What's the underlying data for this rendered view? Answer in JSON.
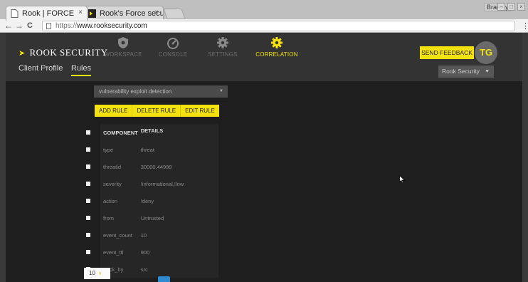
{
  "browser": {
    "tabs": [
      {
        "title": "Rook | FORCE",
        "close": "×"
      },
      {
        "title": "Rook's Force secur",
        "close": "×"
      }
    ],
    "user": "Bradley",
    "window_controls": [
      "–",
      "□",
      "×"
    ],
    "nav": {
      "back": "←",
      "forward": "→",
      "reload": "C"
    },
    "url": {
      "protocol": "https://",
      "host": "www.rooksecurity.com"
    },
    "menu": "⋮"
  },
  "app": {
    "logo": {
      "mark": "➤",
      "text": "ROOK  SECURITY"
    },
    "nav": [
      {
        "label": "WORKSPACE",
        "icon": "shield-icon",
        "active": false
      },
      {
        "label": "CONSOLE",
        "icon": "gauge-icon",
        "active": false
      },
      {
        "label": "SETTINGS",
        "icon": "gear-icon",
        "active": false
      },
      {
        "label": "CORRELATION",
        "icon": "gear-icon",
        "active": true
      }
    ],
    "subnav": [
      "Client Profile",
      "Rules"
    ],
    "feedback": "SEND FEEDBACK",
    "avatar": "TG",
    "org": {
      "value": "Rook Security",
      "caret": "▼"
    },
    "accent": "#f4e20e"
  },
  "rules": {
    "selected_rule": "vulnerability exploit detection",
    "caret": "▼",
    "actions": [
      "ADD RULE",
      "DELETE RULE",
      "EDIT RULE"
    ],
    "columns": [
      "COMPONENT",
      "DETAILS"
    ],
    "rows": [
      {
        "component": "type",
        "details": "threat"
      },
      {
        "component": "threatid",
        "details": "30000,44999"
      },
      {
        "component": "severity",
        "details": "!informational,!low"
      },
      {
        "component": "action",
        "details": "!deny"
      },
      {
        "component": "from",
        "details": "Untrusted"
      },
      {
        "component": "event_count",
        "details": "10"
      },
      {
        "component": "event_ttl",
        "details": "900"
      },
      {
        "component": "track_by",
        "details": "src"
      }
    ],
    "page_size": "10",
    "page_size_caret": "∨"
  }
}
